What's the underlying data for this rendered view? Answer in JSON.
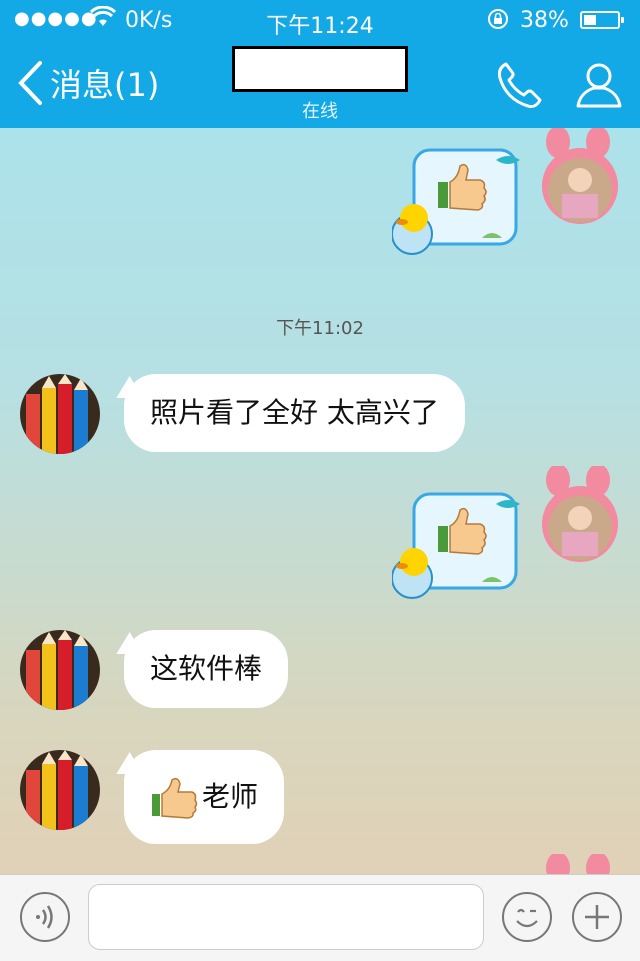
{
  "status": {
    "signal": "●●●●●",
    "speed": "0K/s",
    "time": "下午11:24",
    "battery_pct": "38%",
    "battery_level": 0.38
  },
  "nav": {
    "back_label": "消息(1)",
    "contact_name": "",
    "presence": "在线"
  },
  "messages": [
    {
      "side": "me",
      "type": "sticker"
    },
    {
      "type": "time",
      "text": "下午11:02"
    },
    {
      "side": "peer",
      "type": "text",
      "text": "照片看了全好 太高兴了"
    },
    {
      "side": "me",
      "type": "sticker"
    },
    {
      "side": "peer",
      "type": "text",
      "text": "这软件棒"
    },
    {
      "side": "peer",
      "type": "text",
      "text": "老师",
      "emoji": "thumbs-up"
    }
  ],
  "input": {
    "value": "",
    "placeholder": ""
  },
  "icons": {
    "back": "chevron-left-icon",
    "call": "phone-icon",
    "profile": "person-icon",
    "voice": "voice-icon",
    "emoji": "smiley-icon",
    "plus": "plus-icon"
  },
  "colors": {
    "header": "#12a9e6",
    "bubble": "#ffffff"
  }
}
